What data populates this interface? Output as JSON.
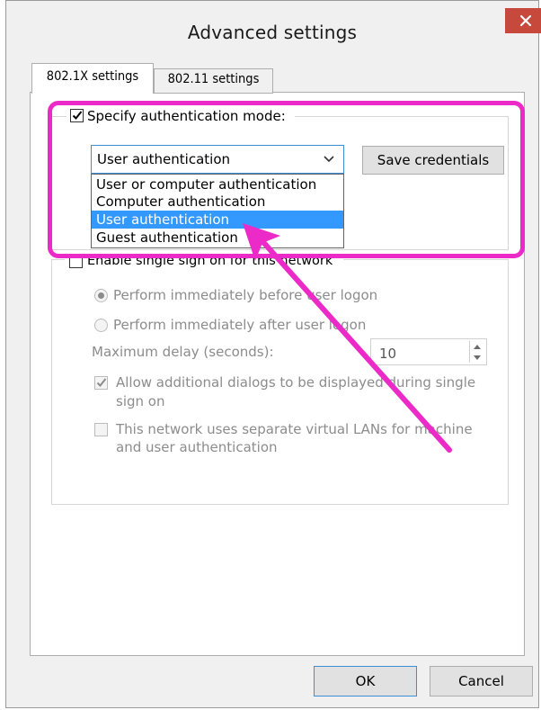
{
  "window": {
    "title": "Advanced settings",
    "close_label": "×"
  },
  "tabs": [
    {
      "label": "802.1X settings",
      "active": true
    },
    {
      "label": "802.11 settings",
      "active": false
    }
  ],
  "auth_mode": {
    "checkbox_label": "Specify authentication mode:",
    "checked": true,
    "selected_value": "User authentication",
    "options": [
      "User or computer authentication",
      "Computer authentication",
      "User authentication",
      "Guest authentication"
    ],
    "highlighted_index": 2,
    "save_credentials_label": "Save credentials"
  },
  "sso": {
    "checkbox_label": "Enable single sign on for this network",
    "checked": false,
    "radio_before": "Perform immediately before user logon",
    "radio_after": "Perform immediately after user logon",
    "radio_selected": "before",
    "max_delay_label": "Maximum delay (seconds):",
    "max_delay_value": "10",
    "allow_dialogs_line1": "Allow additional dialogs to be displayed during single",
    "allow_dialogs_line2": "sign on",
    "allow_dialogs_checked": true,
    "vlans_line1": "This network uses separate virtual LANs for machine",
    "vlans_line2": "and user authentication",
    "vlans_checked": false
  },
  "footer": {
    "ok_label": "OK",
    "cancel_label": "Cancel"
  },
  "annotation": {
    "color": "#ec2ac7"
  },
  "colors": {
    "selection": "#3399ff",
    "close_button": "#c7493b",
    "focus_border": "#3c8fd6"
  }
}
